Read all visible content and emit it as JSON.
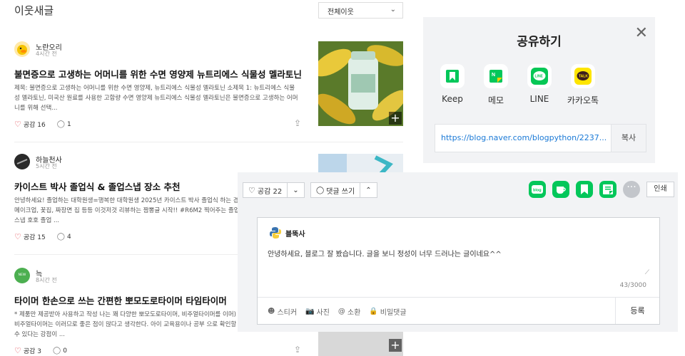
{
  "feed": {
    "title": "이웃새글",
    "filter_label": "전체이웃",
    "posts": [
      {
        "author": "노란오리",
        "time": "4시간 전",
        "title": "불면증으로 고생하는 어머니를 위한 수면 영양제 뉴트리에스 식물성 멜라토닌",
        "excerpt": "제목: 불면증으로 고생하는 어머니를 위한 수면 영양제, 뉴트리에스 식물성 멜라토닌 소제목 1: 뉴트리에스 식물성 멜라토닌, 미국산 원료를 사용한 고함량 수면 영양제 뉴트리에스 식물성 멜라토닌은 불면증으로 고생하는 어머니를 위해 선택...",
        "likes": "공감 16",
        "comments": "1"
      },
      {
        "author": "하늘천사",
        "time": "5시간 전",
        "title": "카이스트 박사 졸업식 & 졸업스냅 장소 추천",
        "excerpt": "안녕하세요! 졸업하는 대학원생=행복한 대학원생 2025년 카이스트 박사 졸업식 하는 겸 메이크업, 꽃집, 짜장면 집 등등 이것저것 리뷰하는 짬뽕글 시작!! #R6M2 찍어주는 졸업스냅 호호 졸업 ...",
        "likes": "공감 15",
        "comments": "4"
      },
      {
        "author": "늑",
        "time": "8시간 전",
        "title": "타이머 한손으로 쓰는 간편한 뽀모도로타이머 타임타이머",
        "excerpt": "* 제품만 제공받아 사용하고 작성 나는 꽤 다양한 뽀모도로타이머, 비주얼타이머를 이머) 비주얼타이머는 이러므로 좋은 점이 많다고 생각한다. 아이 교육용이나 공부 으로 확인할 수 있다는 강점이 ...",
        "likes": "공감 3",
        "comments": "0",
        "avatar_text": "NEW"
      }
    ]
  },
  "share": {
    "title": "공유하기",
    "services": [
      {
        "label": "Keep",
        "icon": "keep-icon"
      },
      {
        "label": "메모",
        "icon": "memo-icon"
      },
      {
        "label": "LINE",
        "icon": "line-icon"
      },
      {
        "label": "카카오톡",
        "icon": "kakaotalk-icon"
      }
    ],
    "url": "https://blog.naver.com/blogpython/2237...",
    "copy_label": "복사"
  },
  "comment_panel": {
    "like_label": "공감 22",
    "comment_label": "댓글 쓰기",
    "print_label": "인쇄",
    "commenter": "블뚝사",
    "comment_text": "안녕하세요, 블로그 잘 봤습니다. 글을 보니 정성이 너무 드러나는 글이네요^^",
    "count": "43/3000",
    "tools": [
      "스티커",
      "사진",
      "소환",
      "비밀댓글"
    ],
    "submit_label": "등록",
    "colors": {
      "naver_green": "#03c75a",
      "heart_red": "#e0333d",
      "link_blue": "#1a79d6"
    }
  }
}
